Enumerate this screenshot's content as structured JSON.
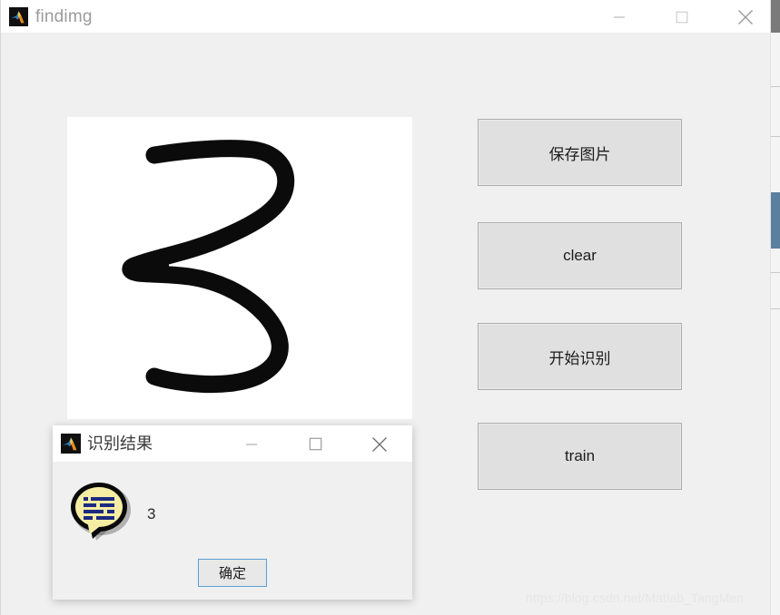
{
  "window": {
    "title": "findimg",
    "icon": "matlab-icon",
    "controls": {
      "minimize": "minimize-icon",
      "maximize": "maximize-icon",
      "close": "close-icon"
    }
  },
  "canvas": {
    "name": "drawing-canvas",
    "drawn_digit": "3",
    "stroke_color": "#0a0a0a",
    "background": "#ffffff"
  },
  "buttons": [
    {
      "id": "save-image-button",
      "label": "保存图片"
    },
    {
      "id": "clear-button",
      "label": "clear"
    },
    {
      "id": "start-recognition-button",
      "label": "开始识别"
    },
    {
      "id": "train-button",
      "label": "train"
    }
  ],
  "watermark": {
    "text": "https://blog.csdn.net/Matlab_TangMen"
  },
  "dialog": {
    "title": "识别结果",
    "icon": "matlab-icon",
    "message_icon": "speech-bubble-icon",
    "message": "3",
    "ok_label": "确定",
    "controls": {
      "minimize": "minimize-icon",
      "maximize": "maximize-icon",
      "close": "close-icon"
    },
    "focus_color": "#5a9fd4"
  },
  "colors": {
    "window_background": "#f0f0f0",
    "titlebar": "#ffffff",
    "button_face": "#e0e0e0",
    "button_border": "#adadad",
    "title_text": "#9b9b9b",
    "icon_bubble_fill": "#f5eda0",
    "icon_bubble_lines": "#1b2a80"
  }
}
